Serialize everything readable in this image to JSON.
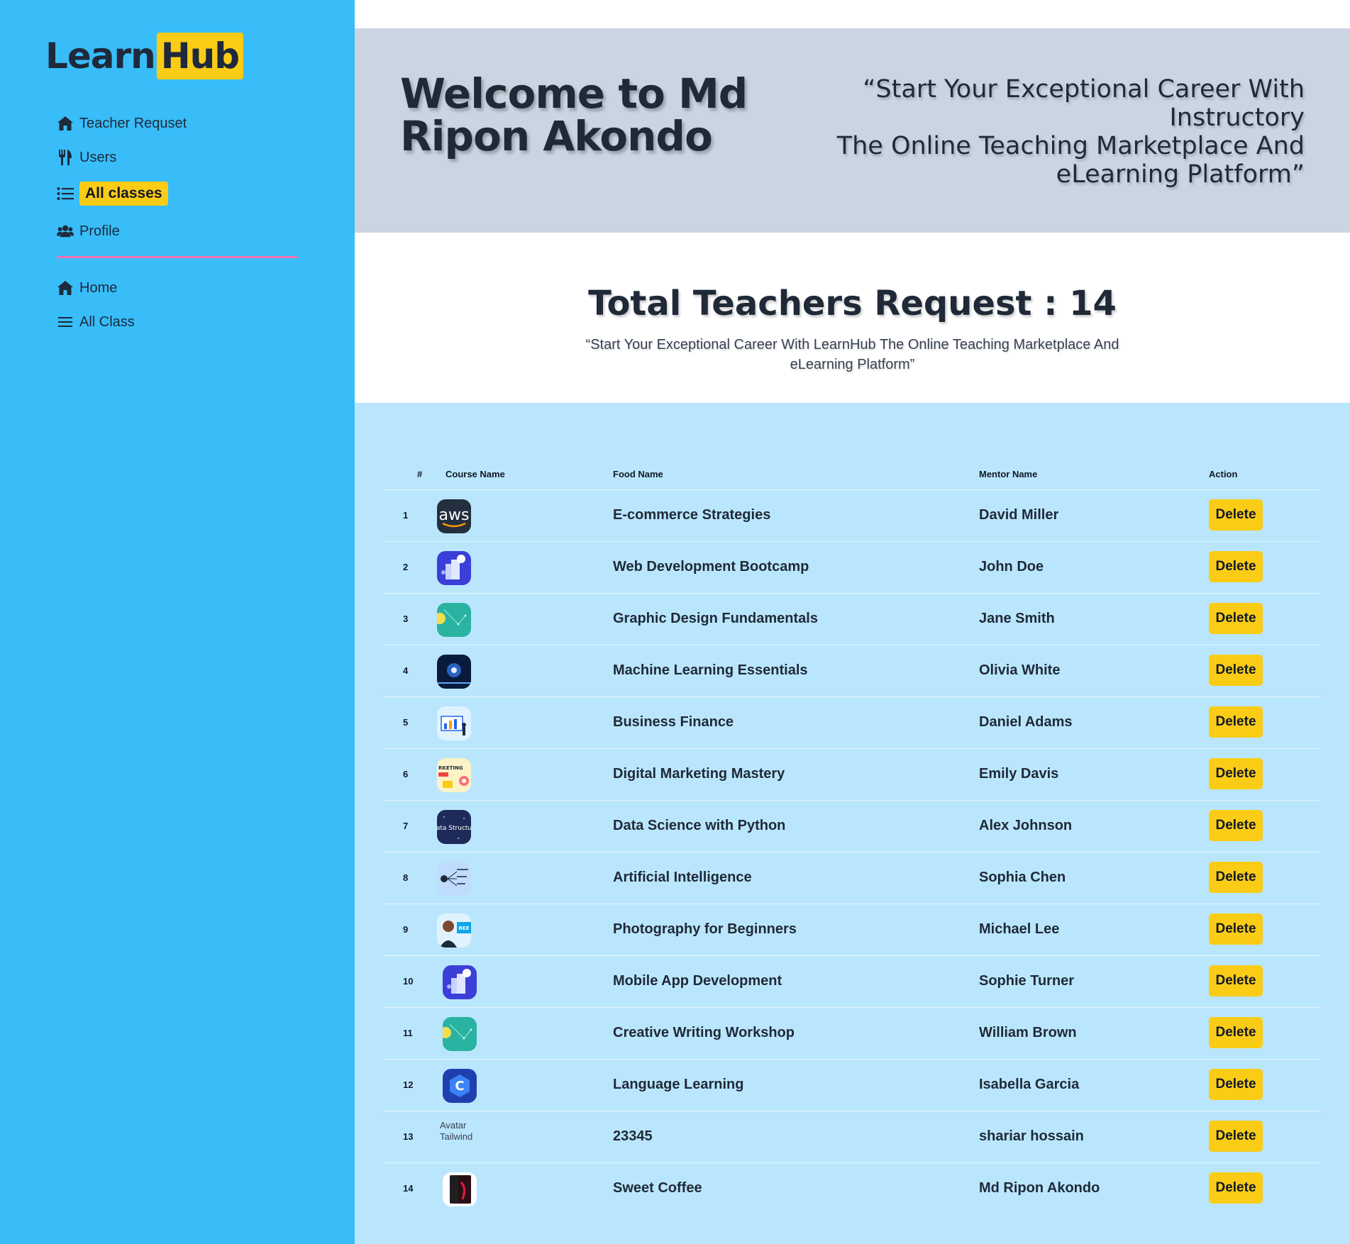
{
  "logo": {
    "part1": "Learn",
    "part2": "Hub"
  },
  "sidebar": {
    "items": [
      {
        "label": "Teacher Requset",
        "icon": "home-icon"
      },
      {
        "label": "Users",
        "icon": "utensils-icon"
      },
      {
        "label": "All classes",
        "icon": "list-icon",
        "active": true
      },
      {
        "label": "Profile",
        "icon": "users-icon"
      }
    ],
    "secondary": [
      {
        "label": "Home",
        "icon": "home-icon"
      },
      {
        "label": "All Class",
        "icon": "menu-icon"
      }
    ]
  },
  "hero": {
    "title": "Welcome to Md Ripon Akondo",
    "quote_line1": "“Start Your Exceptional Career With Instructory",
    "quote_line2": "The Online Teaching Marketplace And eLearning Platform”"
  },
  "section": {
    "title": "Total Teachers Request : 14",
    "subtitle": "“Start Your Exceptional Career With LearnHub The Online Teaching Marketplace And eLearning Platform”"
  },
  "table": {
    "headers": {
      "num": "#",
      "course": "Course Name",
      "food": "Food Name",
      "mentor": "Mentor Name",
      "action": "Action"
    },
    "delete_label": "Delete",
    "rows": [
      {
        "num": "1",
        "course": "E-commerce Strategies",
        "mentor": "David Miller",
        "thumb": "aws-thumbnail"
      },
      {
        "num": "2",
        "course": "Web Development Bootcamp",
        "mentor": "John Doe",
        "thumb": "web-dev-thumbnail"
      },
      {
        "num": "3",
        "course": "Graphic Design Fundamentals",
        "mentor": "Jane Smith",
        "thumb": "graphic-design-thumbnail"
      },
      {
        "num": "4",
        "course": "Machine Learning Essentials",
        "mentor": "Olivia White",
        "thumb": "machine-learning-thumbnail"
      },
      {
        "num": "5",
        "course": "Business Finance",
        "mentor": "Daniel Adams",
        "thumb": "business-thumbnail"
      },
      {
        "num": "6",
        "course": "Digital Marketing Mastery",
        "mentor": "Emily Davis",
        "thumb": "marketing-thumbnail"
      },
      {
        "num": "7",
        "course": "Data Science with Python",
        "mentor": "Alex Johnson",
        "thumb": "data-structure-thumbnail"
      },
      {
        "num": "8",
        "course": "Artificial Intelligence",
        "mentor": "Sophia Chen",
        "thumb": "ai-thumbnail"
      },
      {
        "num": "9",
        "course": "Photography for Beginners",
        "mentor": "Michael Lee",
        "thumb": "photography-thumbnail"
      },
      {
        "num": "10",
        "course": "Mobile App Development",
        "mentor": "Sophie Turner",
        "thumb": "mobile-app-thumbnail"
      },
      {
        "num": "11",
        "course": "Creative Writing Workshop",
        "mentor": "William Brown",
        "thumb": "creative-writing-thumbnail"
      },
      {
        "num": "12",
        "course": "Language Learning",
        "mentor": "Isabella Garcia",
        "thumb": "language-thumbnail"
      },
      {
        "num": "13",
        "course": "23345",
        "mentor": "shariar hossain",
        "thumb": "broken-image",
        "alt": "Avatar Tailwind"
      },
      {
        "num": "14",
        "course": "Sweet Coffee",
        "mentor": "Md Ripon Akondo",
        "thumb": "phone-thumbnail"
      }
    ]
  },
  "colors": {
    "sidebar": "#38bdf8",
    "accent": "#facc15",
    "hero": "#cbd5e1",
    "panel": "#bae6fd",
    "divider": "#f472b6"
  }
}
